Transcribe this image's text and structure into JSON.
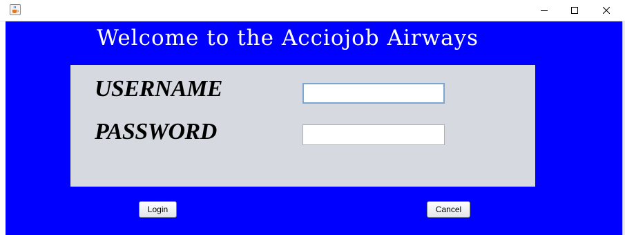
{
  "window": {
    "title": "",
    "icons": {
      "app": "java-cup-icon",
      "minimize": "minimize-icon",
      "maximize": "maximize-icon",
      "close": "close-icon"
    }
  },
  "form": {
    "heading": "Welcome to the Acciojob Airways",
    "username_label": "USERNAME",
    "password_label": "PASSWORD",
    "username_value": "",
    "password_value": "",
    "login_label": "Login",
    "cancel_label": "Cancel"
  },
  "colors": {
    "background": "#0000ff",
    "panel": "#d6d9e0",
    "heading_text": "#ffffff",
    "label_text": "#000000"
  }
}
